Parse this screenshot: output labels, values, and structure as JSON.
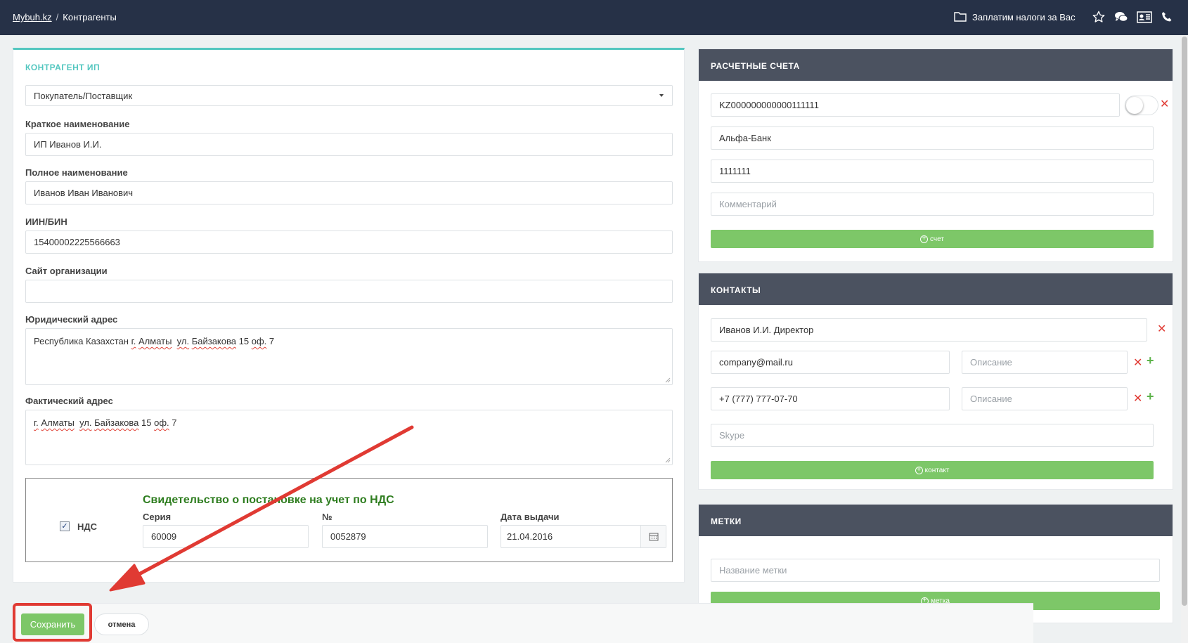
{
  "topbar": {
    "breadcrumb_home": "Mybuh.kz",
    "breadcrumb_sep": "/",
    "breadcrumb_current": "Контрагенты",
    "tax_label": "Заплатим налоги за Вас",
    "icons": [
      "folder-icon",
      "star-icon",
      "chat-icon",
      "contact-card-icon",
      "phone-icon"
    ]
  },
  "form": {
    "section_title": "КОНТРАГЕНТ ИП",
    "type_select": "Покупатель/Поставщик",
    "short_name_label": "Краткое наименование",
    "short_name": "ИП Иванов И.И.",
    "full_name_label": "Полное наименование",
    "full_name": "Иванов Иван Иванович",
    "iin_label": "ИИН/БИН",
    "iin": "15400002225566663",
    "site_label": "Сайт организации",
    "site": "",
    "legal_address_label": "Юридический адрес",
    "legal_address": {
      "country": "Республика Казахстан",
      "g": "г.",
      "city": "Алматы",
      "ul": "ул.",
      "street": "Байзакова",
      "num": "15",
      "of": "оф.",
      "office": "7"
    },
    "actual_address_label": "Фактический адрес",
    "actual_address": {
      "g": "г.",
      "city": "Алматы",
      "ul": "ул.",
      "street": "Байзакова",
      "num": "15",
      "of": "оф.",
      "office": "7"
    },
    "vat": {
      "checked": true,
      "label": "НДС",
      "cert_title": "Свидетельство о постановке на учет по НДС",
      "series_label": "Серия",
      "series": "60009",
      "number_label": "№",
      "number": "0052879",
      "date_label": "Дата выдачи",
      "date": "21.04.2016"
    }
  },
  "accounts": {
    "title": "РАСЧЕТНЫЕ СЧЕТА",
    "iban": "KZ000000000000111111",
    "bank": "Альфа-Банк",
    "bik": "1111111",
    "comment_placeholder": "Комментарий",
    "add_label": "счет"
  },
  "contacts": {
    "title": "КОНТАКТЫ",
    "person": "Иванов И.И. Директор",
    "email": "company@mail.ru",
    "phone": "+7 (777) 777-07-70",
    "desc_placeholder": "Описание",
    "skype_placeholder": "Skype",
    "add_label": "контакт"
  },
  "tags": {
    "title": "МЕТКИ",
    "placeholder": "Название метки",
    "add_label": "метка"
  },
  "actions": {
    "save": "Сохранить",
    "cancel": "отмена"
  },
  "colors": {
    "topbar": "#263147",
    "accent_teal": "#54c7c0",
    "button_green": "#7dc768",
    "highlight_red": "#e03a33",
    "panel_header": "#4b5260"
  }
}
